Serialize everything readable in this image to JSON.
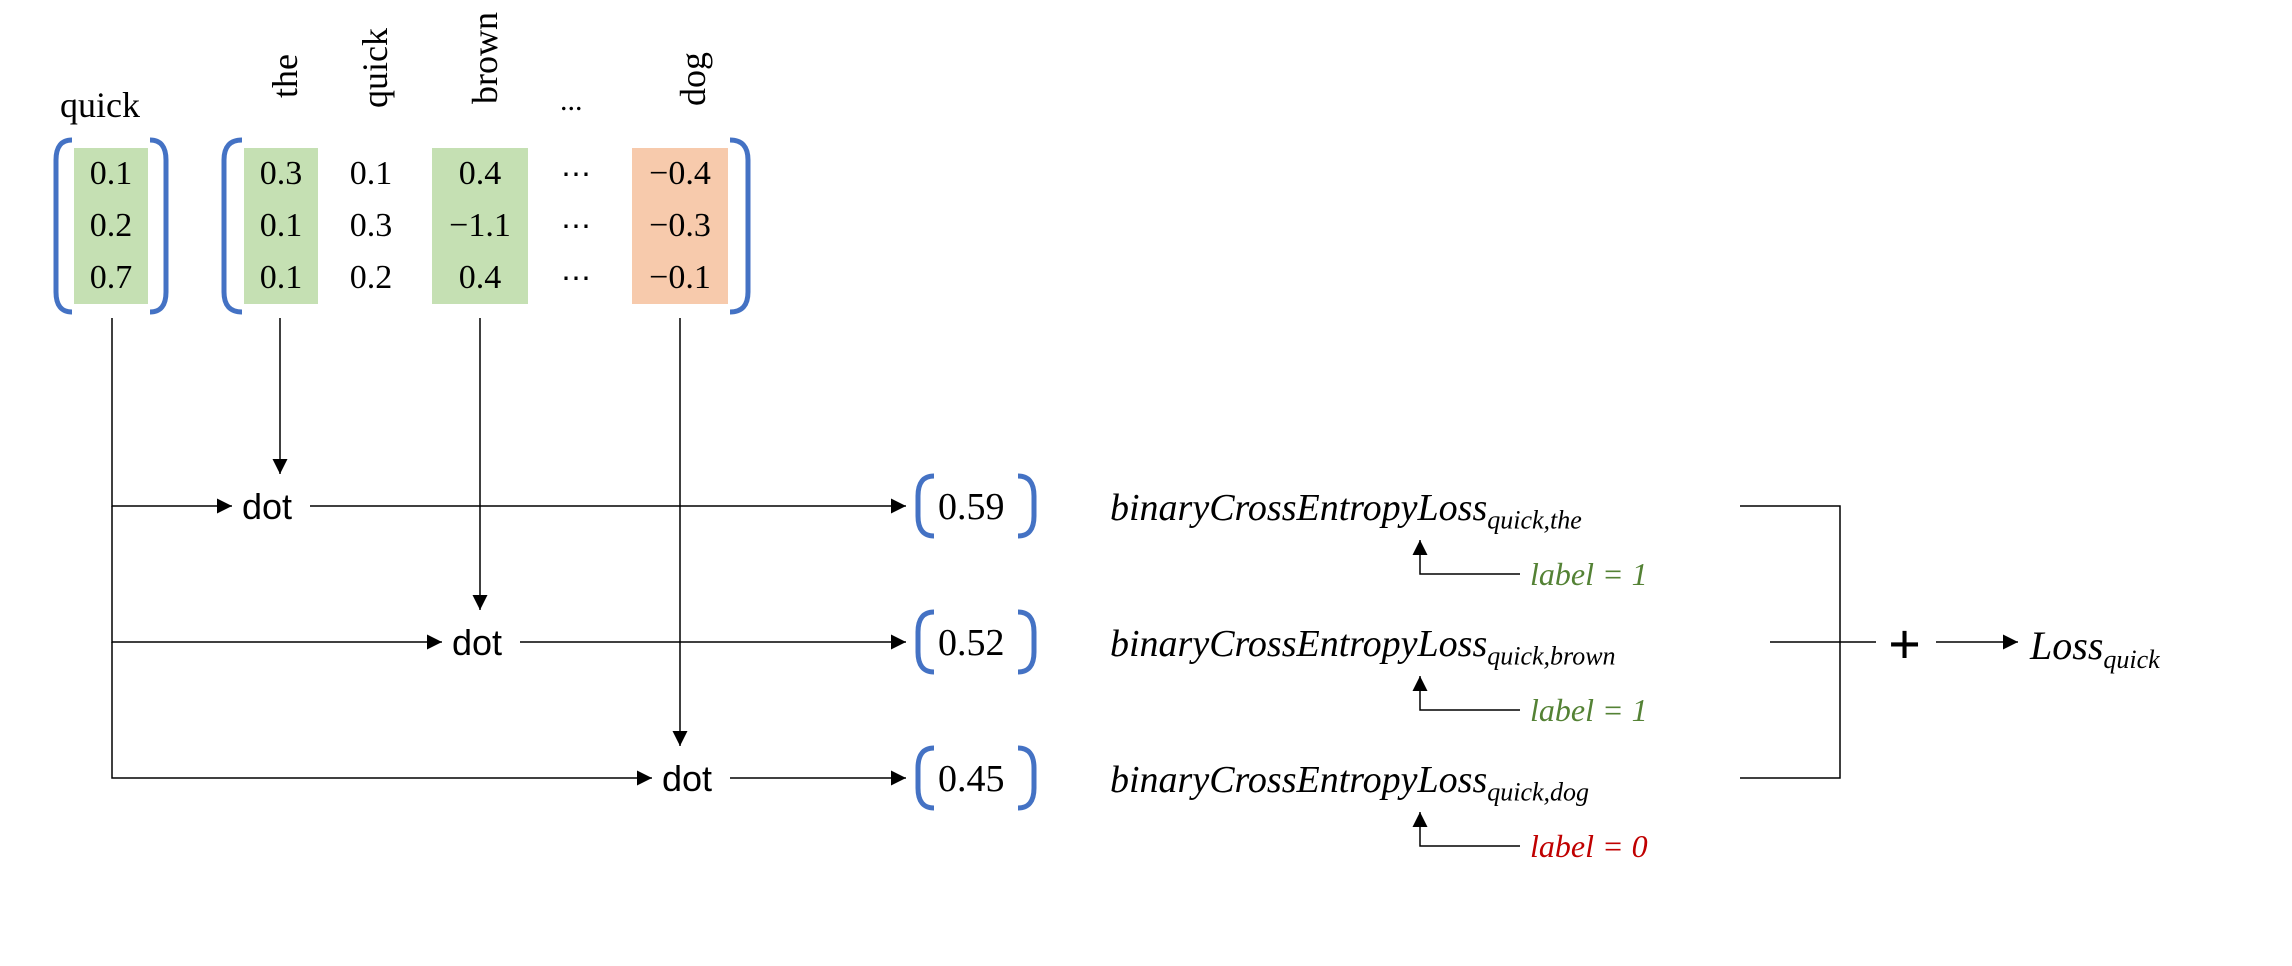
{
  "left_vector": {
    "label": "quick",
    "values": [
      "0.1",
      "0.2",
      "0.7"
    ]
  },
  "matrix": {
    "column_labels": [
      "the",
      "quick",
      "brown",
      "...",
      "dog"
    ],
    "columns": [
      {
        "highlight": "green",
        "values": [
          "0.3",
          "0.1",
          "0.1"
        ]
      },
      {
        "highlight": "none",
        "values": [
          "0.1",
          "0.3",
          "0.2"
        ]
      },
      {
        "highlight": "green",
        "values": [
          "0.4",
          "−1.1",
          "0.4"
        ]
      },
      {
        "highlight": "dots",
        "values": [
          "⋯",
          "⋯",
          "⋯"
        ]
      },
      {
        "highlight": "orange",
        "values": [
          "−0.4",
          "−0.3",
          "−0.1"
        ]
      }
    ]
  },
  "dot_label": "dot",
  "results": [
    "0.59",
    "0.52",
    "0.45"
  ],
  "loss_terms": [
    {
      "name": "binaryCrossEntropyLoss",
      "sub": "quick,the",
      "label_text": "label = 1",
      "label_color": "g"
    },
    {
      "name": "binaryCrossEntropyLoss",
      "sub": "quick,brown",
      "label_text": "label = 1",
      "label_color": "g"
    },
    {
      "name": "binaryCrossEntropyLoss",
      "sub": "quick,dog",
      "label_text": "label = 0",
      "label_color": "r"
    }
  ],
  "plus": "+",
  "final_loss": {
    "name": "Loss",
    "sub": "quick"
  },
  "colors": {
    "bracket": "#4472c4",
    "green_bg": "#c5e0b3",
    "orange_bg": "#f7caac",
    "green_text": "#548235",
    "red_text": "#c00000"
  }
}
